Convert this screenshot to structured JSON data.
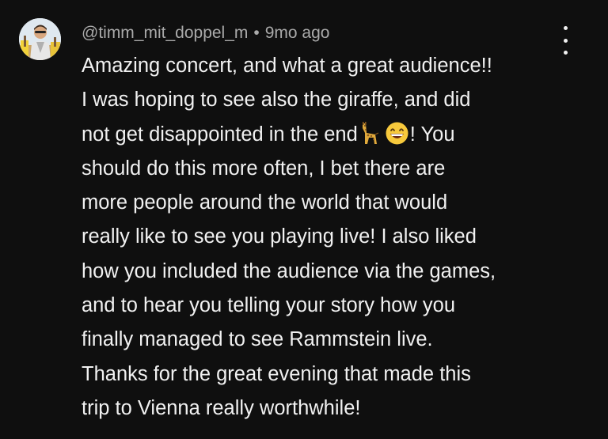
{
  "comment": {
    "author": "@timm_mit_doppel_m",
    "separator": "•",
    "time": "9mo ago",
    "avatar_icon": "user-avatar-photo",
    "menu_icon": "more-vertical-icon",
    "lines": [
      "Amazing concert, and what a great audience!!",
      "I was hoping to see also the giraffe, and did",
      {
        "before": "not get disappointed in the end",
        "emoji_1": "giraffe-emoji",
        "emoji_2": "grinning-face-emoji",
        "after": "! You"
      },
      "should do this more often, I bet there are",
      "more people around the world that would",
      "really like to see you playing live! I also liked",
      "how you included the audience via the games,",
      "and to hear you telling your story how you",
      "finally managed to see Rammstein live.",
      "Thanks for the great evening that made this",
      "trip to Vienna really worthwhile!"
    ]
  },
  "colors": {
    "background": "#0f0f0f",
    "text": "#f1f1f1",
    "meta_text": "#aaaaaa"
  }
}
